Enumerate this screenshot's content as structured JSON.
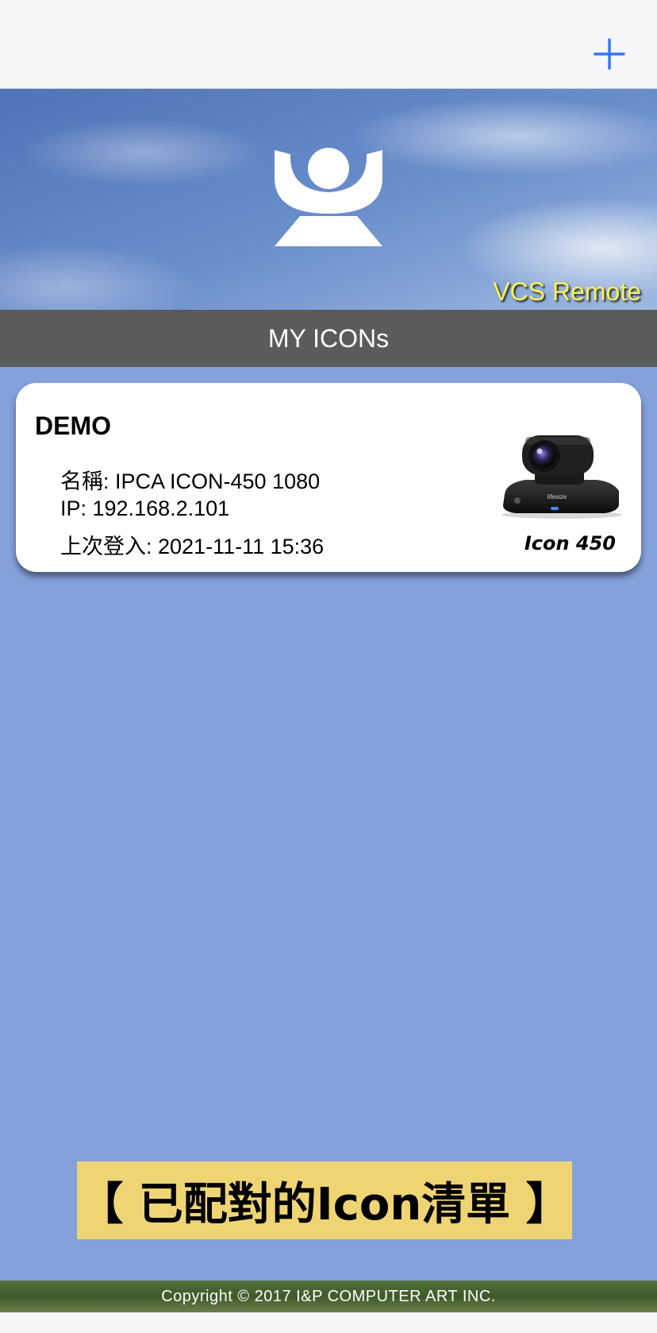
{
  "nav": {
    "add_icon": "plus-icon"
  },
  "hero": {
    "caption": "VCS Remote",
    "logo_icon": "webcam-logo-icon"
  },
  "section": {
    "title": "MY ICONs"
  },
  "device": {
    "title": "DEMO",
    "name_line": "名稱: IPCA ICON-450 1080",
    "ip_line": "IP: 192.168.2.101",
    "login_line": "上次登入: 2021-11-11 15:36",
    "camera_brand": "lifesize",
    "model_label": "Icon 450"
  },
  "banner": {
    "text": "【 已配對的Icon清單 】"
  },
  "footer": {
    "copyright": "Copyright © 2017 I&P COMPUTER ART INC."
  },
  "colors": {
    "accent": "#3478f6",
    "header_bg": "#5b5b5d",
    "list_bg": "#85a1dc",
    "banner_bg": "#efd474",
    "caption": "#f6f25a"
  }
}
